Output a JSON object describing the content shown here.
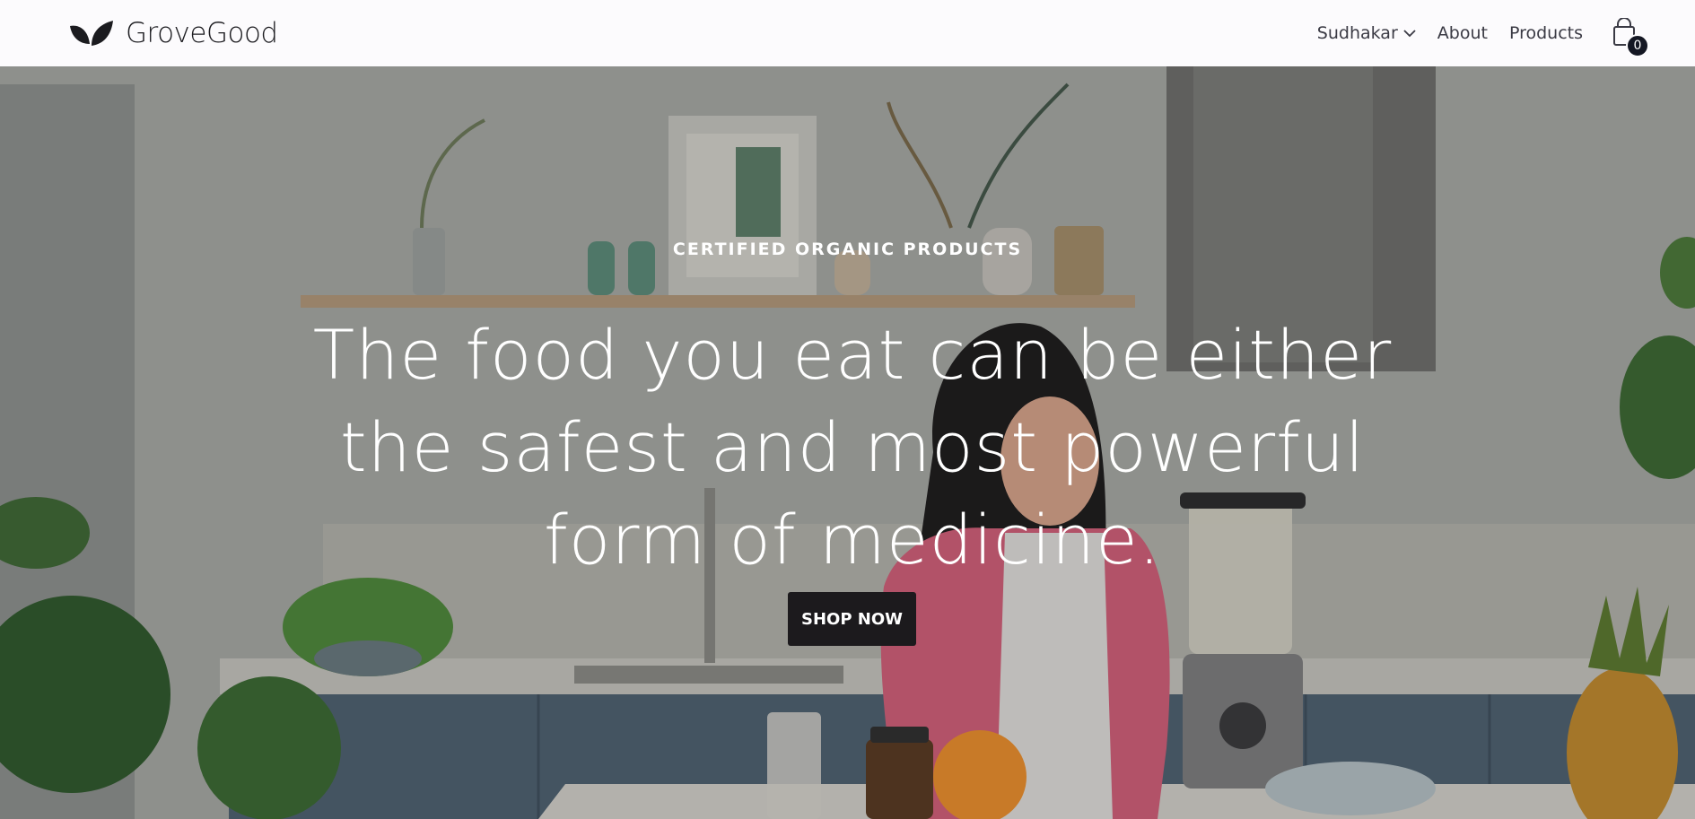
{
  "header": {
    "brand_name": "GroveGood",
    "brand_icon": "leaves-icon",
    "nav": {
      "user_label": "Sudhakar",
      "about_label": "About",
      "products_label": "Products"
    },
    "cart": {
      "icon": "shopping-bag-icon",
      "count": "0"
    }
  },
  "hero": {
    "eyebrow": "CERTIFIED ORGANIC PRODUCTS",
    "headline": "The food you eat can be either the safest and most powerful form of medicine.",
    "cta_label": "SHOP NOW"
  },
  "colors": {
    "header_bg": "#fcfbfd",
    "text_dark": "#1b1b1f",
    "button_bg": "#1c1a1d",
    "badge_bg": "#141723"
  }
}
